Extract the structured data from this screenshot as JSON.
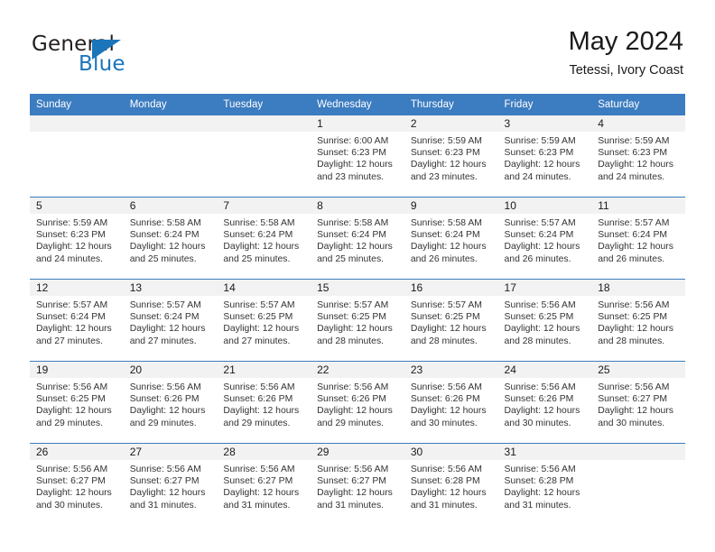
{
  "brand": {
    "name_top": "General",
    "name_bottom": "Blue",
    "accent_color": "#1b75bb"
  },
  "header": {
    "title": "May 2024",
    "location": "Tetessi, Ivory Coast"
  },
  "theme": {
    "header_row_color": "#3c7cc0",
    "daynum_band_color": "#f2f2f2",
    "text_color": "#333333"
  },
  "weekday_headers": [
    "Sunday",
    "Monday",
    "Tuesday",
    "Wednesday",
    "Thursday",
    "Friday",
    "Saturday"
  ],
  "weeks": [
    [
      {
        "day": "",
        "sunrise": "",
        "sunset": "",
        "daylight_line1": "",
        "daylight_line2": ""
      },
      {
        "day": "",
        "sunrise": "",
        "sunset": "",
        "daylight_line1": "",
        "daylight_line2": ""
      },
      {
        "day": "",
        "sunrise": "",
        "sunset": "",
        "daylight_line1": "",
        "daylight_line2": ""
      },
      {
        "day": "1",
        "sunrise": "Sunrise: 6:00 AM",
        "sunset": "Sunset: 6:23 PM",
        "daylight_line1": "Daylight: 12 hours",
        "daylight_line2": "and 23 minutes."
      },
      {
        "day": "2",
        "sunrise": "Sunrise: 5:59 AM",
        "sunset": "Sunset: 6:23 PM",
        "daylight_line1": "Daylight: 12 hours",
        "daylight_line2": "and 23 minutes."
      },
      {
        "day": "3",
        "sunrise": "Sunrise: 5:59 AM",
        "sunset": "Sunset: 6:23 PM",
        "daylight_line1": "Daylight: 12 hours",
        "daylight_line2": "and 24 minutes."
      },
      {
        "day": "4",
        "sunrise": "Sunrise: 5:59 AM",
        "sunset": "Sunset: 6:23 PM",
        "daylight_line1": "Daylight: 12 hours",
        "daylight_line2": "and 24 minutes."
      }
    ],
    [
      {
        "day": "5",
        "sunrise": "Sunrise: 5:59 AM",
        "sunset": "Sunset: 6:23 PM",
        "daylight_line1": "Daylight: 12 hours",
        "daylight_line2": "and 24 minutes."
      },
      {
        "day": "6",
        "sunrise": "Sunrise: 5:58 AM",
        "sunset": "Sunset: 6:24 PM",
        "daylight_line1": "Daylight: 12 hours",
        "daylight_line2": "and 25 minutes."
      },
      {
        "day": "7",
        "sunrise": "Sunrise: 5:58 AM",
        "sunset": "Sunset: 6:24 PM",
        "daylight_line1": "Daylight: 12 hours",
        "daylight_line2": "and 25 minutes."
      },
      {
        "day": "8",
        "sunrise": "Sunrise: 5:58 AM",
        "sunset": "Sunset: 6:24 PM",
        "daylight_line1": "Daylight: 12 hours",
        "daylight_line2": "and 25 minutes."
      },
      {
        "day": "9",
        "sunrise": "Sunrise: 5:58 AM",
        "sunset": "Sunset: 6:24 PM",
        "daylight_line1": "Daylight: 12 hours",
        "daylight_line2": "and 26 minutes."
      },
      {
        "day": "10",
        "sunrise": "Sunrise: 5:57 AM",
        "sunset": "Sunset: 6:24 PM",
        "daylight_line1": "Daylight: 12 hours",
        "daylight_line2": "and 26 minutes."
      },
      {
        "day": "11",
        "sunrise": "Sunrise: 5:57 AM",
        "sunset": "Sunset: 6:24 PM",
        "daylight_line1": "Daylight: 12 hours",
        "daylight_line2": "and 26 minutes."
      }
    ],
    [
      {
        "day": "12",
        "sunrise": "Sunrise: 5:57 AM",
        "sunset": "Sunset: 6:24 PM",
        "daylight_line1": "Daylight: 12 hours",
        "daylight_line2": "and 27 minutes."
      },
      {
        "day": "13",
        "sunrise": "Sunrise: 5:57 AM",
        "sunset": "Sunset: 6:24 PM",
        "daylight_line1": "Daylight: 12 hours",
        "daylight_line2": "and 27 minutes."
      },
      {
        "day": "14",
        "sunrise": "Sunrise: 5:57 AM",
        "sunset": "Sunset: 6:25 PM",
        "daylight_line1": "Daylight: 12 hours",
        "daylight_line2": "and 27 minutes."
      },
      {
        "day": "15",
        "sunrise": "Sunrise: 5:57 AM",
        "sunset": "Sunset: 6:25 PM",
        "daylight_line1": "Daylight: 12 hours",
        "daylight_line2": "and 28 minutes."
      },
      {
        "day": "16",
        "sunrise": "Sunrise: 5:57 AM",
        "sunset": "Sunset: 6:25 PM",
        "daylight_line1": "Daylight: 12 hours",
        "daylight_line2": "and 28 minutes."
      },
      {
        "day": "17",
        "sunrise": "Sunrise: 5:56 AM",
        "sunset": "Sunset: 6:25 PM",
        "daylight_line1": "Daylight: 12 hours",
        "daylight_line2": "and 28 minutes."
      },
      {
        "day": "18",
        "sunrise": "Sunrise: 5:56 AM",
        "sunset": "Sunset: 6:25 PM",
        "daylight_line1": "Daylight: 12 hours",
        "daylight_line2": "and 28 minutes."
      }
    ],
    [
      {
        "day": "19",
        "sunrise": "Sunrise: 5:56 AM",
        "sunset": "Sunset: 6:25 PM",
        "daylight_line1": "Daylight: 12 hours",
        "daylight_line2": "and 29 minutes."
      },
      {
        "day": "20",
        "sunrise": "Sunrise: 5:56 AM",
        "sunset": "Sunset: 6:26 PM",
        "daylight_line1": "Daylight: 12 hours",
        "daylight_line2": "and 29 minutes."
      },
      {
        "day": "21",
        "sunrise": "Sunrise: 5:56 AM",
        "sunset": "Sunset: 6:26 PM",
        "daylight_line1": "Daylight: 12 hours",
        "daylight_line2": "and 29 minutes."
      },
      {
        "day": "22",
        "sunrise": "Sunrise: 5:56 AM",
        "sunset": "Sunset: 6:26 PM",
        "daylight_line1": "Daylight: 12 hours",
        "daylight_line2": "and 29 minutes."
      },
      {
        "day": "23",
        "sunrise": "Sunrise: 5:56 AM",
        "sunset": "Sunset: 6:26 PM",
        "daylight_line1": "Daylight: 12 hours",
        "daylight_line2": "and 30 minutes."
      },
      {
        "day": "24",
        "sunrise": "Sunrise: 5:56 AM",
        "sunset": "Sunset: 6:26 PM",
        "daylight_line1": "Daylight: 12 hours",
        "daylight_line2": "and 30 minutes."
      },
      {
        "day": "25",
        "sunrise": "Sunrise: 5:56 AM",
        "sunset": "Sunset: 6:27 PM",
        "daylight_line1": "Daylight: 12 hours",
        "daylight_line2": "and 30 minutes."
      }
    ],
    [
      {
        "day": "26",
        "sunrise": "Sunrise: 5:56 AM",
        "sunset": "Sunset: 6:27 PM",
        "daylight_line1": "Daylight: 12 hours",
        "daylight_line2": "and 30 minutes."
      },
      {
        "day": "27",
        "sunrise": "Sunrise: 5:56 AM",
        "sunset": "Sunset: 6:27 PM",
        "daylight_line1": "Daylight: 12 hours",
        "daylight_line2": "and 31 minutes."
      },
      {
        "day": "28",
        "sunrise": "Sunrise: 5:56 AM",
        "sunset": "Sunset: 6:27 PM",
        "daylight_line1": "Daylight: 12 hours",
        "daylight_line2": "and 31 minutes."
      },
      {
        "day": "29",
        "sunrise": "Sunrise: 5:56 AM",
        "sunset": "Sunset: 6:27 PM",
        "daylight_line1": "Daylight: 12 hours",
        "daylight_line2": "and 31 minutes."
      },
      {
        "day": "30",
        "sunrise": "Sunrise: 5:56 AM",
        "sunset": "Sunset: 6:28 PM",
        "daylight_line1": "Daylight: 12 hours",
        "daylight_line2": "and 31 minutes."
      },
      {
        "day": "31",
        "sunrise": "Sunrise: 5:56 AM",
        "sunset": "Sunset: 6:28 PM",
        "daylight_line1": "Daylight: 12 hours",
        "daylight_line2": "and 31 minutes."
      },
      {
        "day": "",
        "sunrise": "",
        "sunset": "",
        "daylight_line1": "",
        "daylight_line2": ""
      }
    ]
  ]
}
